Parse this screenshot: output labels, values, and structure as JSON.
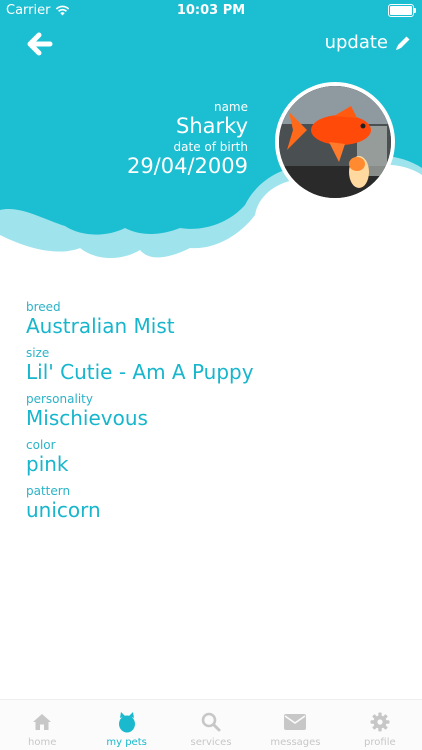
{
  "status_bar": {
    "carrier": "Carrier",
    "time": "10:03 PM"
  },
  "header": {
    "update_label": "update"
  },
  "pet": {
    "name_label": "name",
    "name": "Sharky",
    "dob_label": "date of birth",
    "dob": "29/04/2009"
  },
  "details": [
    {
      "label": "breed",
      "value": "Australian Mist"
    },
    {
      "label": "size",
      "value": "Lil' Cutie - Am A Puppy"
    },
    {
      "label": "personality",
      "value": "Mischievous"
    },
    {
      "label": "color",
      "value": "pink"
    },
    {
      "label": "pattern",
      "value": "unicorn"
    }
  ],
  "tabs": [
    {
      "label": "home",
      "icon": "home-icon"
    },
    {
      "label": "my pets",
      "icon": "pet-icon",
      "active": true
    },
    {
      "label": "services",
      "icon": "search-icon"
    },
    {
      "label": "messages",
      "icon": "envelope-icon"
    },
    {
      "label": "profile",
      "icon": "gear-icon"
    }
  ],
  "colors": {
    "accent": "#1ab9ce",
    "accent_light": "#9fe3ec",
    "inactive": "#c7c7c7"
  }
}
